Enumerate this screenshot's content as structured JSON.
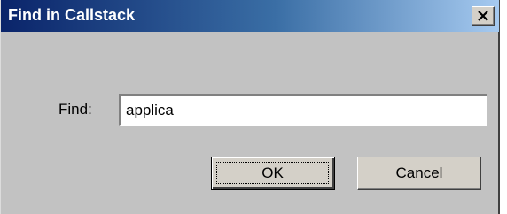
{
  "dialog": {
    "title": "Find in Callstack",
    "close_icon": "close-icon",
    "find_label": "Find:",
    "find_value": "applica",
    "ok_label": "OK",
    "cancel_label": "Cancel"
  },
  "colors": {
    "title_gradient_start": "#0a246a",
    "title_gradient_end": "#a6caf0",
    "dialog_background": "#c2c2c2"
  }
}
